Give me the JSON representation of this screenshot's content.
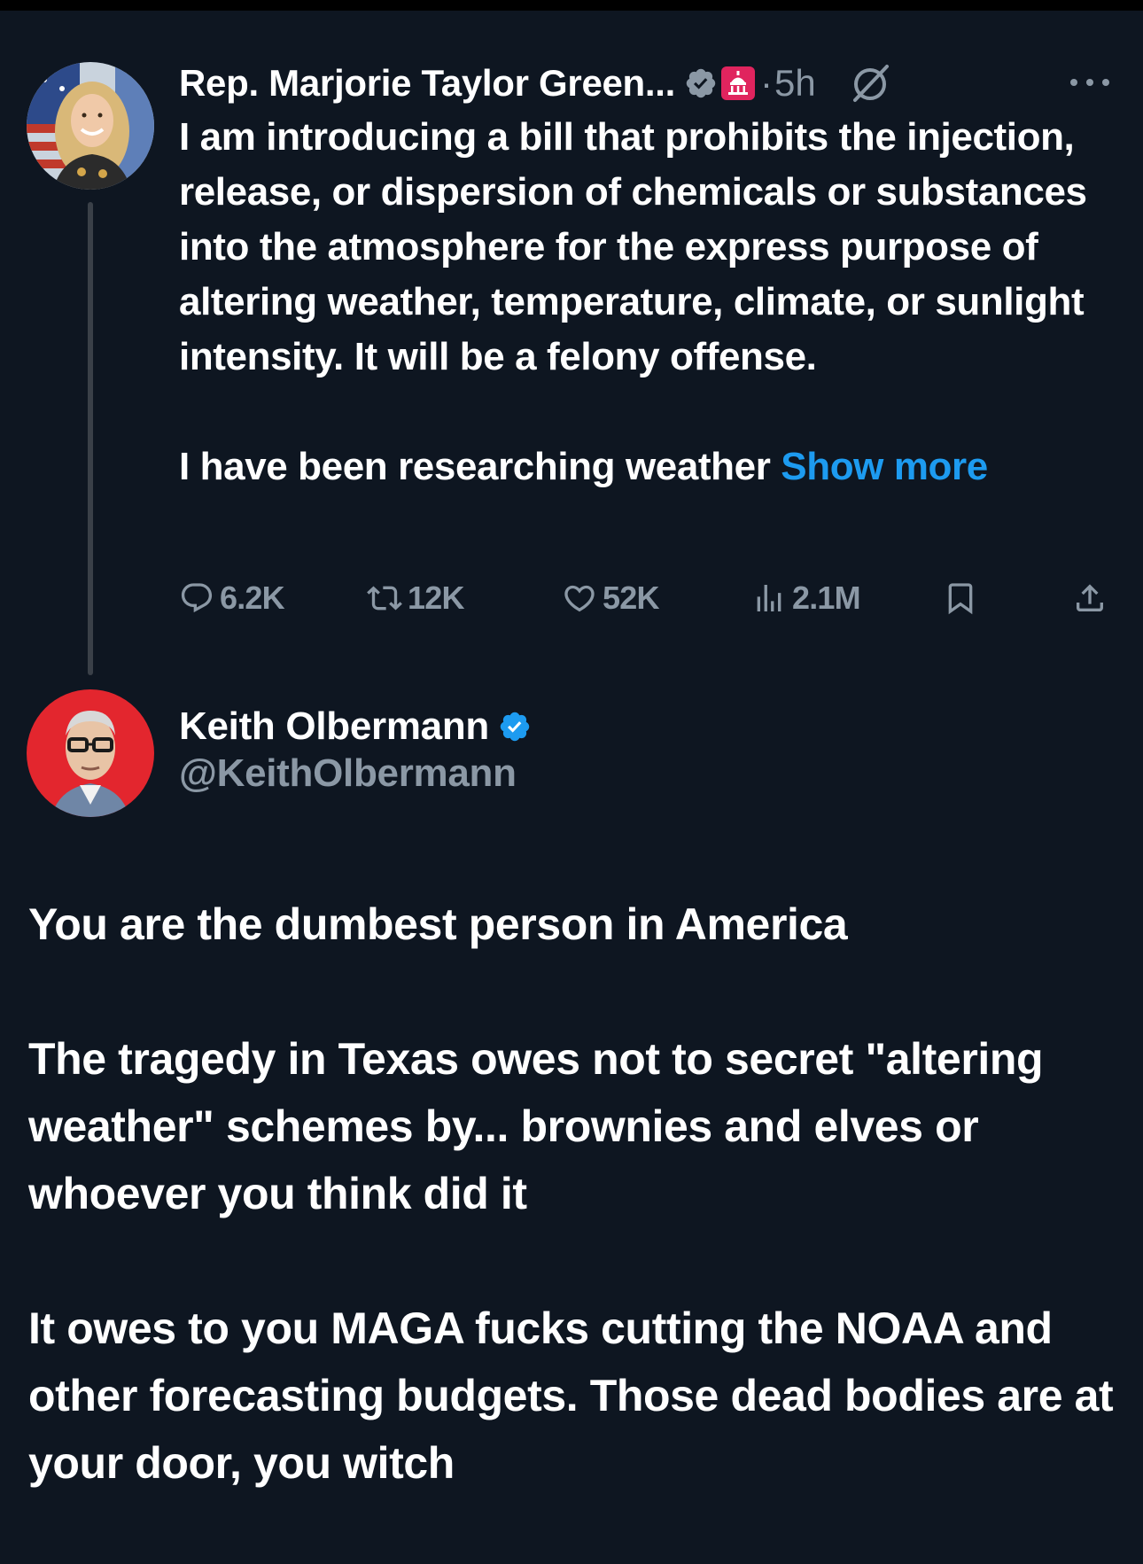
{
  "parent_tweet": {
    "author_name": "Rep. Marjorie Taylor Green...",
    "time_separator": "·",
    "time": "5h",
    "text_para1": "I am introducing a bill that prohibits the injection, release, or dispersion of chemicals or substances into the atmosphere for the express purpose of altering weather, temperature, climate, or sunlight intensity. It will be a felony offense.",
    "text_para2": "I have been researching weather",
    "show_more": "Show more",
    "stats": {
      "replies": "6.2K",
      "reposts": "12K",
      "likes": "52K",
      "views": "2.1M"
    },
    "icons": [
      "verified-icon",
      "capitol-icon",
      "grok-icon",
      "more-icon",
      "reply-icon",
      "repost-icon",
      "like-icon",
      "views-icon",
      "bookmark-icon",
      "share-icon"
    ]
  },
  "reply_tweet": {
    "author_name": "Keith Olbermann",
    "handle": "@KeithOlbermann",
    "paragraphs": [
      "You are the dumbest person in America",
      "The tragedy in Texas owes not to secret \"altering weather\" schemes by... brownies and elves or whoever you think did it",
      "It owes to you MAGA fucks cutting the NOAA and other forecasting budgets. Those dead bodies are at your door, you witch"
    ]
  },
  "colors": {
    "background": "#0e1621",
    "text": "#ffffff",
    "muted": "#8b98a5",
    "link": "#1d9bf0",
    "verified": "#1d9bf0",
    "badge": "#e0245e"
  }
}
